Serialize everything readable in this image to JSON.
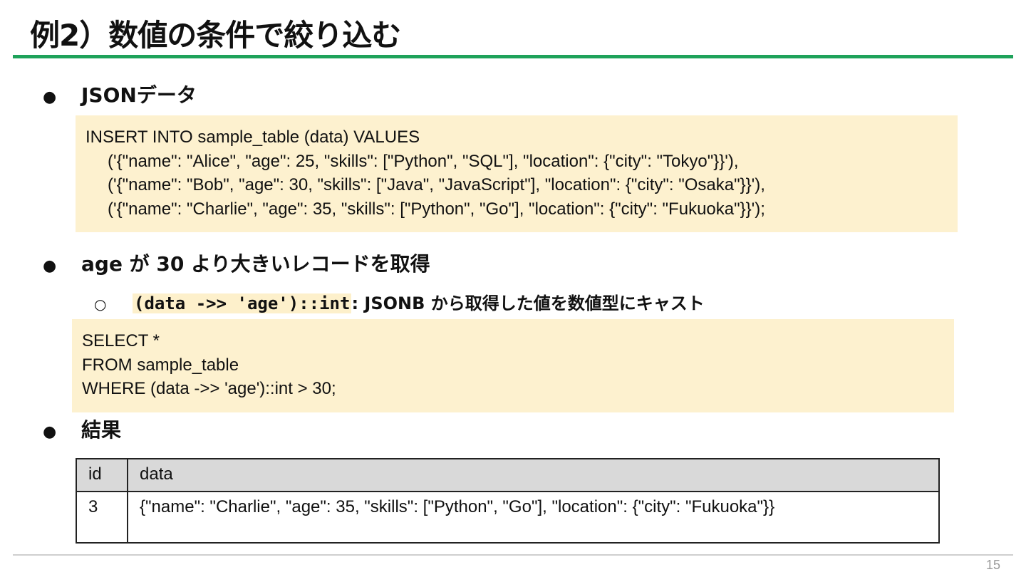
{
  "slide": {
    "title": "例2）数値の条件で絞り込む",
    "page_number": "15",
    "accent_color": "#1ea25a"
  },
  "sections": {
    "json_data": {
      "bullet": "●",
      "heading": "JSONデータ",
      "code": {
        "line1": "INSERT INTO sample_table (data) VALUES",
        "line2": "('{\"name\": \"Alice\", \"age\": 25, \"skills\": [\"Python\", \"SQL\"], \"location\": {\"city\": \"Tokyo\"}}'),",
        "line3": "('{\"name\": \"Bob\", \"age\": 30, \"skills\": [\"Java\", \"JavaScript\"], \"location\": {\"city\": \"Osaka\"}}'),",
        "line4": "('{\"name\": \"Charlie\", \"age\": 35, \"skills\": [\"Python\", \"Go\"], \"location\": {\"city\": \"Fukuoka\"}}');"
      }
    },
    "filter": {
      "bullet": "●",
      "heading": "age が 30 より大きいレコードを取得",
      "sub_bullet": "○",
      "note_code": "(data ->> 'age')::int",
      "note_text": ": JSONB から取得した値を数値型にキャスト",
      "code": {
        "line1": "SELECT *",
        "line2": "FROM sample_table",
        "line3": "WHERE (data ->> 'age')::int > 30;"
      }
    },
    "result": {
      "bullet": "●",
      "heading": "結果",
      "table": {
        "columns": [
          "id",
          "data"
        ],
        "rows": [
          [
            "3",
            "{\"name\": \"Charlie\", \"age\": 35, \"skills\": [\"Python\", \"Go\"], \"location\": {\"city\": \"Fukuoka\"}}"
          ]
        ]
      }
    }
  }
}
